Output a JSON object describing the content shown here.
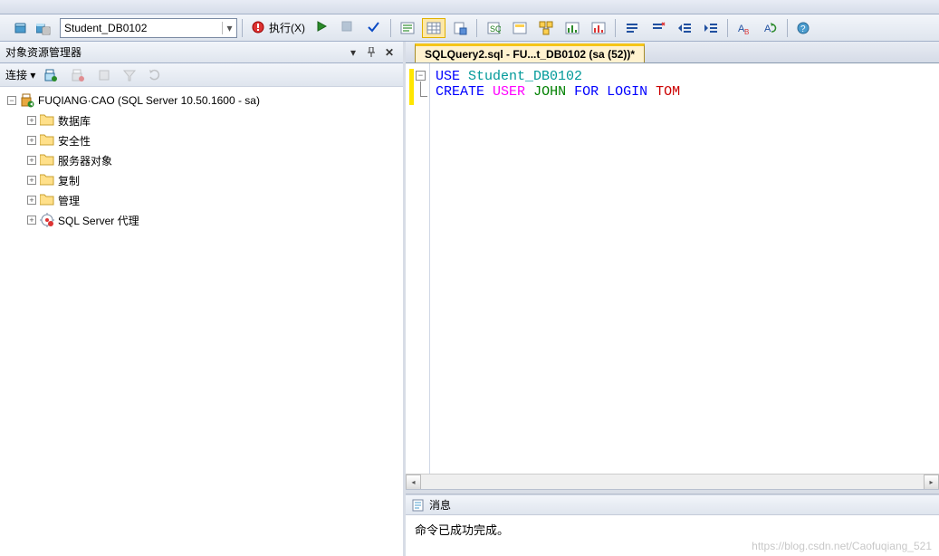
{
  "toolbar": {
    "db_selector": "Student_DB0102",
    "execute_label": "执行(X)",
    "icons": {
      "small_left_1": "db-refresh-icon",
      "small_left_2": "db-list-icon",
      "exclaim": "execute-icon",
      "play": "play-icon",
      "debug": "debug-icon",
      "check": "parse-check-icon"
    }
  },
  "explorer": {
    "title": "对象资源管理器",
    "connect_label": "连接 ▾",
    "server": "FUQIANG·CAO (SQL Server 10.50.1600 - sa)",
    "nodes": [
      {
        "label": "数据库"
      },
      {
        "label": "安全性"
      },
      {
        "label": "服务器对象"
      },
      {
        "label": "复制"
      },
      {
        "label": "管理"
      },
      {
        "label": "SQL Server 代理"
      }
    ]
  },
  "editor_tab": "SQLQuery2.sql - FU...t_DB0102 (sa (52))*",
  "sql": {
    "line1": {
      "use": "USE",
      "db": "Student_DB0102"
    },
    "line2": {
      "create": "CREATE",
      "user": "USER",
      "john": "JOHN",
      "for": "FOR",
      "login": "LOGIN",
      "tom": "TOM"
    }
  },
  "messages": {
    "tab": "消息",
    "text": "命令已成功完成。"
  },
  "watermark": "https://blog.csdn.net/Caofuqiang_521"
}
